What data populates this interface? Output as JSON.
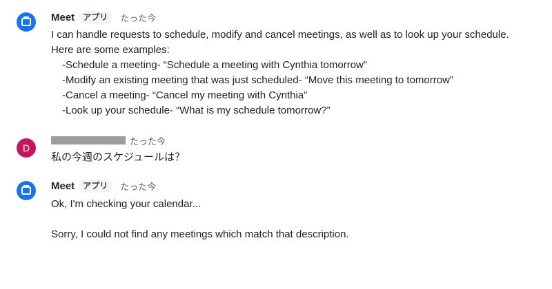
{
  "messages": [
    {
      "sender": "Meet",
      "badge": "アプリ",
      "time": "たった今",
      "intro": "I can handle requests to schedule, modify and cancel meetings, as well as to look up your schedule.",
      "examples_header": "Here are some examples:",
      "examples": [
        "-Schedule a meeting- “Schedule a meeting with Cynthia tomorrow”",
        "-Modify an existing meeting that was just scheduled- “Move this meeting to tomorrow”",
        "-Cancel a meeting- “Cancel my meeting with Cynthia”",
        "-Look up your schedule- “What is my schedule tomorrow?”"
      ]
    },
    {
      "avatar_letter": "D",
      "avatar_color": "#c2185b",
      "time": "たった今",
      "text": "私の今週のスケジュールは？"
    },
    {
      "sender": "Meet",
      "badge": "アプリ",
      "time": "たった今",
      "line1": "Ok, I'm checking your calendar...",
      "line2": "Sorry, I could not find any meetings which match that description."
    }
  ],
  "colors": {
    "meet_avatar": "#1a73e8",
    "text": "#202124",
    "timestamp": "#5f6368"
  },
  "icons": {
    "meet_avatar": "meet-app-icon"
  }
}
